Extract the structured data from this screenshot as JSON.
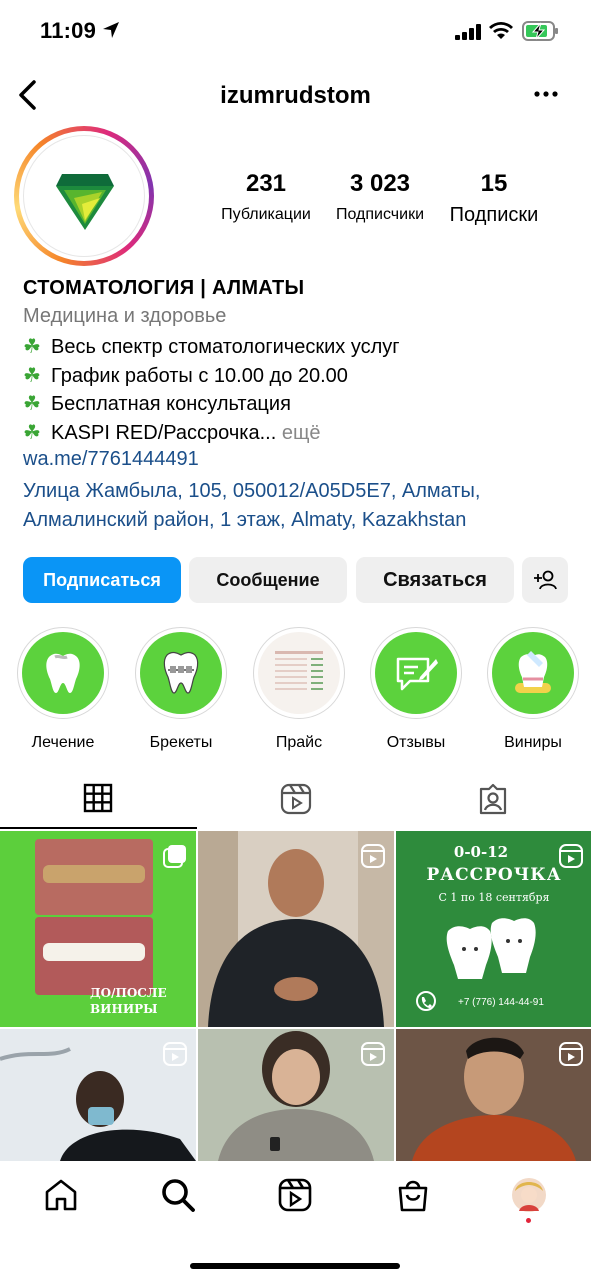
{
  "status_bar": {
    "time": "11:09"
  },
  "header": {
    "username": "izumrudstom"
  },
  "stats": {
    "posts": {
      "count": "231",
      "label": "Публикации"
    },
    "followers": {
      "count": "3 023",
      "label": "Подписчики"
    },
    "following": {
      "count": "15",
      "label": "Подписки"
    }
  },
  "bio": {
    "name": "СТОМАТОЛОГИЯ | АЛМАТЫ",
    "category": "Медицина и здоровье",
    "lines": [
      "Весь спектр стоматологических услуг",
      "График работы с 10.00 до 20.00",
      "Бесплатная консультация",
      "KASPI RED/Рассрочка..."
    ],
    "more": " ещё",
    "link": "wa.me/7761444491",
    "address": "Улица Жамбыла, 105, 050012/A05D5E7, Алматы, Алмалинский район, 1 этаж, Almaty, Kazakhstan"
  },
  "buttons": {
    "follow": "Подписаться",
    "message": "Сообщение",
    "contact": "Связаться"
  },
  "highlights": [
    {
      "label": "Лечение",
      "icon": "tooth-icon"
    },
    {
      "label": "Брекеты",
      "icon": "braces-tooth-icon"
    },
    {
      "label": "Прайс",
      "icon": "price-list-icon"
    },
    {
      "label": "Отзывы",
      "icon": "review-chat-icon"
    },
    {
      "label": "Виниры",
      "icon": "veneer-tooth-icon"
    }
  ],
  "tabs": [
    "grid-icon",
    "reels-icon",
    "tagged-icon"
  ],
  "posts": {
    "p1": {
      "caption_line1": "ДО/ПОСЛЕ",
      "caption_line2": "ВИНИРЫ"
    },
    "p3": {
      "title1": "0-0-12",
      "title2": "РАССРОЧКА",
      "subtitle": "С 1 по 18 сентября",
      "phone": "+7 (776) 144-44-91"
    }
  },
  "colors": {
    "follow_button": "#0a95f6",
    "highlight_green": "#5cd23d",
    "link_blue": "#1b4f8a"
  }
}
